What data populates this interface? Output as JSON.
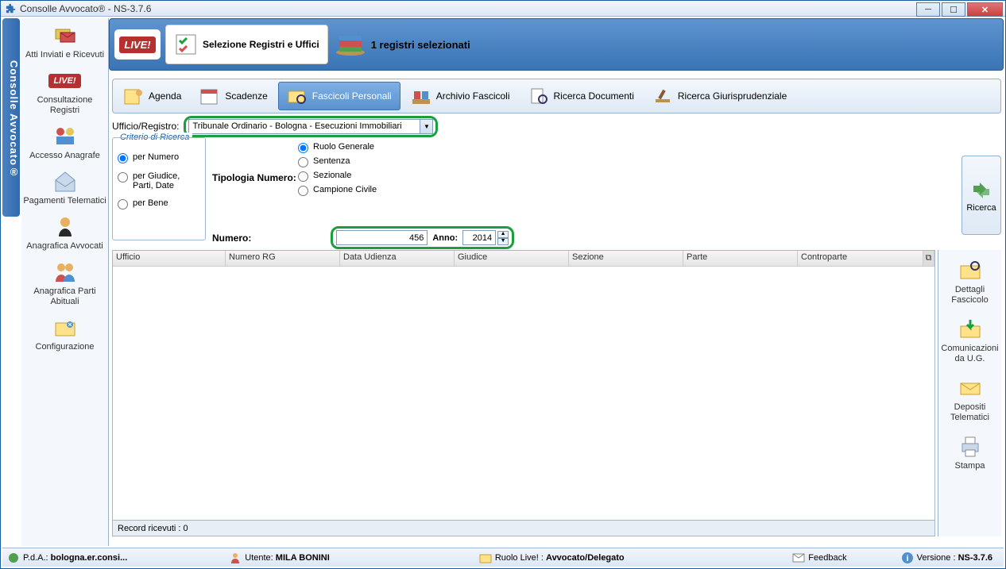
{
  "window": {
    "title": "Consolle Avvocato® - NS-3.7.6"
  },
  "brand": "Consolle Avvocato®",
  "sidebar": {
    "items": [
      {
        "label": "Atti Inviati e Ricevuti"
      },
      {
        "label": "Consultazione Registri",
        "live": "LIVE!"
      },
      {
        "label": "Accesso Anagrafe"
      },
      {
        "label": "Pagamenti Telematici"
      },
      {
        "label": "Anagrafica Avvocati"
      },
      {
        "label": "Anagrafica Parti Abituali"
      },
      {
        "label": "Configurazione"
      }
    ]
  },
  "ribbon": {
    "live": "LIVE!",
    "select_button": "Selezione Registri e Uffici",
    "summary": "1 registri selezionati"
  },
  "tabs": [
    {
      "label": "Agenda"
    },
    {
      "label": "Scadenze"
    },
    {
      "label": "Fascicoli Personali",
      "active": true
    },
    {
      "label": "Archivio Fascicoli"
    },
    {
      "label": "Ricerca Documenti"
    },
    {
      "label": "Ricerca Giurisprudenziale"
    }
  ],
  "filter": {
    "label": "Ufficio/Registro:",
    "value": "Tribunale Ordinario - Bologna - Esecuzioni Immobiliari"
  },
  "criteria": {
    "legend": "Criterio di Ricerca",
    "options": [
      {
        "label": "per Numero",
        "checked": true
      },
      {
        "label": "per Giudice, Parti, Date",
        "checked": false
      },
      {
        "label": "per Bene",
        "checked": false
      }
    ]
  },
  "tipologia": {
    "label": "Tipologia Numero:",
    "options": [
      {
        "label": "Ruolo Generale",
        "checked": true
      },
      {
        "label": "Sentenza",
        "checked": false
      },
      {
        "label": "Sezionale",
        "checked": false
      },
      {
        "label": "Campione Civile",
        "checked": false
      }
    ]
  },
  "numero": {
    "label": "Numero:",
    "value": "456",
    "anno_label": "Anno:",
    "anno_value": "2014"
  },
  "right_actions": {
    "ricerca": "Ricerca",
    "items": [
      {
        "label": "Dettagli Fascicolo"
      },
      {
        "label": "Comunicazioni da U.G."
      },
      {
        "label": "Depositi Telematici"
      },
      {
        "label": "Stampa"
      }
    ]
  },
  "table": {
    "columns": [
      "Ufficio",
      "Numero RG",
      "Data Udienza",
      "Giudice",
      "Sezione",
      "Parte",
      "Controparte"
    ],
    "footer": "Record ricevuti : 0"
  },
  "status": {
    "pda_label": "P.d.A.:",
    "pda_value": "bologna.er.consi...",
    "utente_label": "Utente:",
    "utente_value": "MILA BONINI",
    "ruolo_label": "Ruolo Live! :",
    "ruolo_value": "Avvocato/Delegato",
    "feedback": "Feedback",
    "versione_label": "Versione :",
    "versione_value": "NS-3.7.6"
  }
}
